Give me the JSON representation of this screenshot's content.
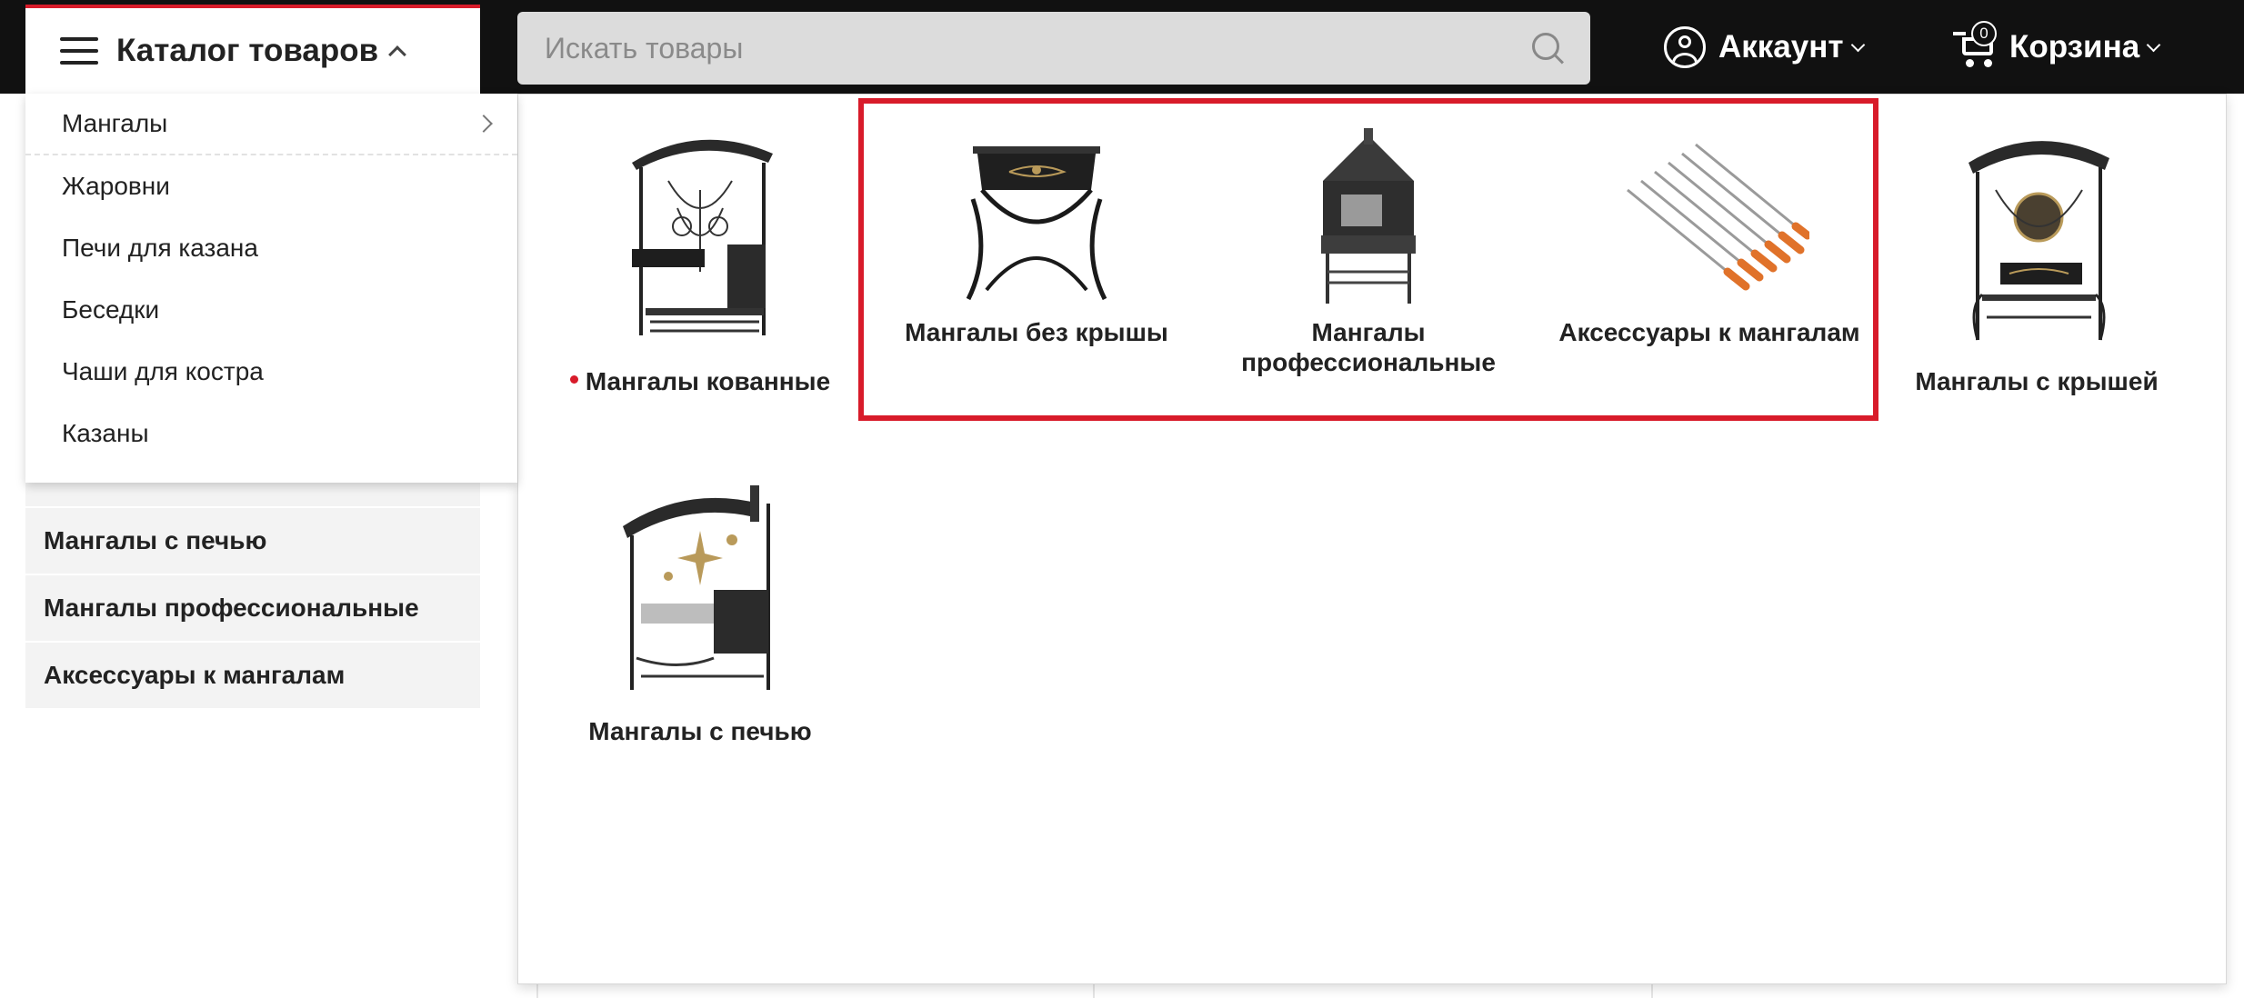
{
  "header": {
    "catalog_label": "Каталог товаров",
    "search_placeholder": "Искать товары",
    "account_label": "Аккаунт",
    "cart_label": "Корзина",
    "cart_count": "0"
  },
  "dropdown": {
    "items": [
      "Мангалы",
      "Жаровни",
      "Печи для казана",
      "Беседки",
      "Чаши для костра",
      "Казаны"
    ]
  },
  "sidebar_bg": {
    "items": [
      "Мангалы с печью",
      "Мангалы профессиональные",
      "Аксессуары к мангалам"
    ]
  },
  "categories": [
    {
      "label": "Мангалы кованные",
      "icon": "forged-grill-image"
    },
    {
      "label": "Мангалы без крышы",
      "icon": "grill-no-roof-image"
    },
    {
      "label": "Мангалы профессиональные",
      "icon": "professional-grill-image"
    },
    {
      "label": "Аксессуары к мангалам",
      "icon": "skewers-image"
    },
    {
      "label": "Мангалы с крышей",
      "icon": "grill-with-roof-image"
    },
    {
      "label": "Мангалы с печью",
      "icon": "grill-with-stove-image"
    }
  ],
  "colors": {
    "accent": "#d81b2a",
    "topbar": "#111111"
  }
}
